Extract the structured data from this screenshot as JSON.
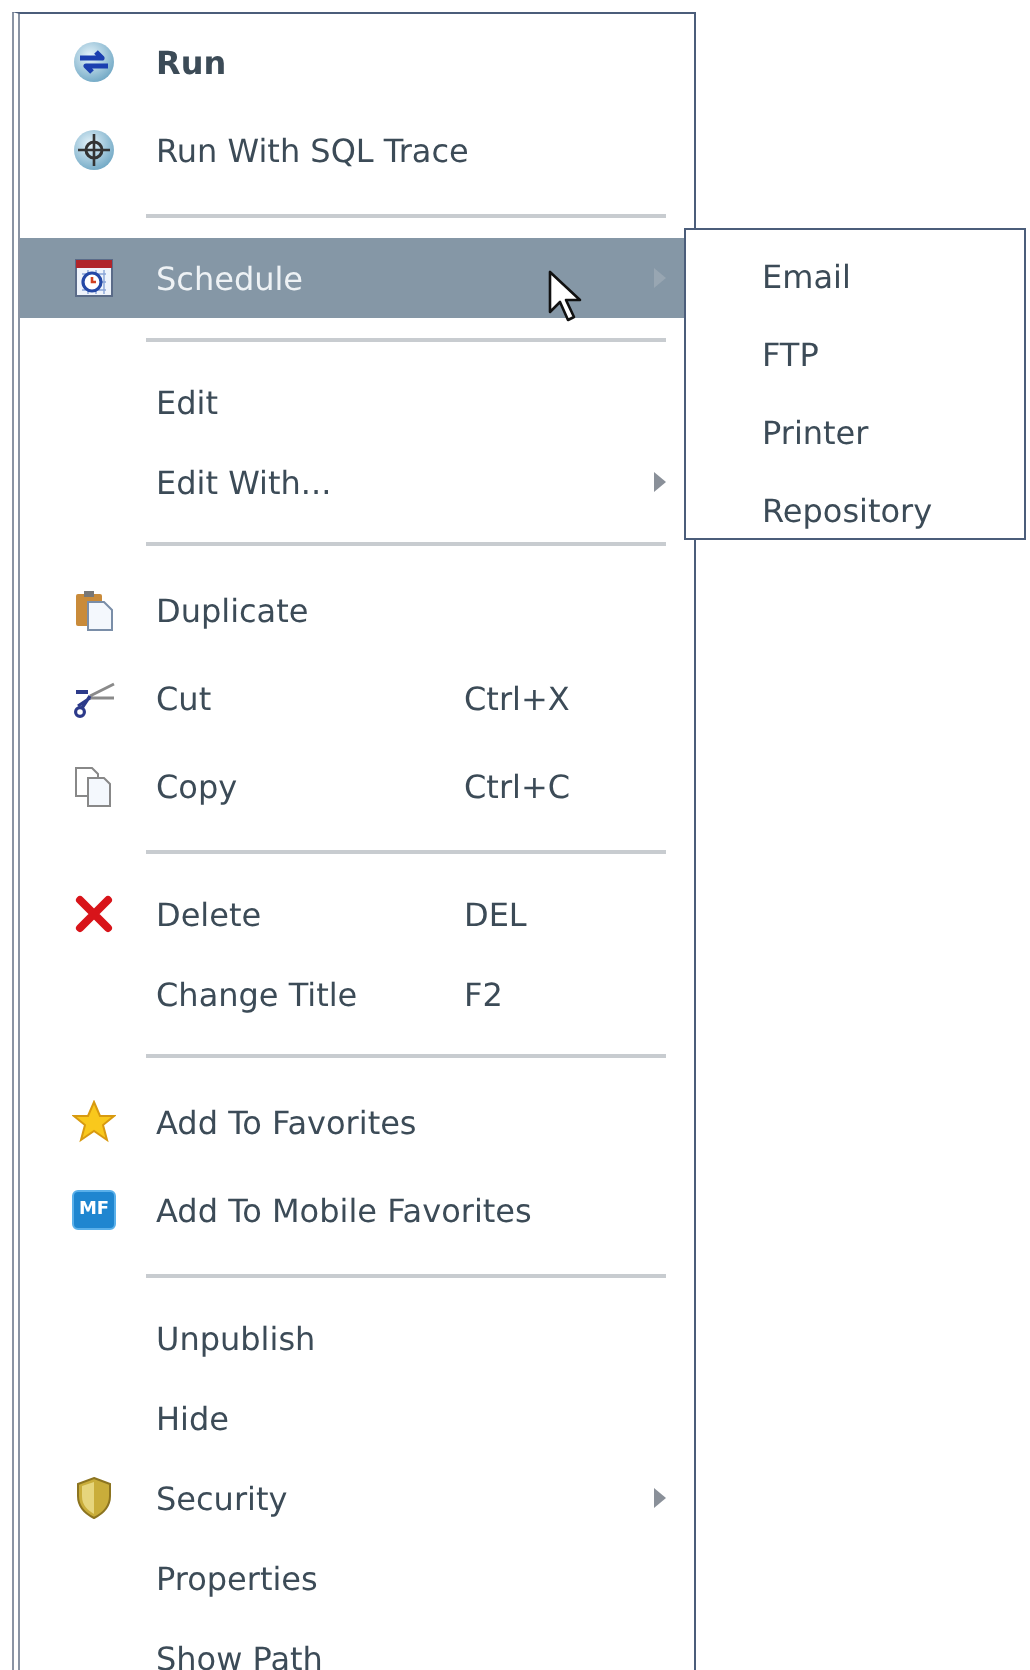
{
  "menu": {
    "items": [
      {
        "kind": "item",
        "label": "Run",
        "default": true,
        "selected": false,
        "submenu": false
      },
      {
        "kind": "item",
        "label": "Run With SQL Trace",
        "default": false,
        "selected": false,
        "submenu": false
      },
      {
        "kind": "separator"
      },
      {
        "kind": "item",
        "label": "Schedule",
        "default": false,
        "selected": true,
        "submenu": true
      },
      {
        "kind": "separator"
      },
      {
        "kind": "item",
        "label": "Edit",
        "default": false,
        "selected": false,
        "submenu": false
      },
      {
        "kind": "item",
        "label": "Edit With...",
        "default": false,
        "selected": false,
        "submenu": true
      },
      {
        "kind": "separator"
      },
      {
        "kind": "item",
        "label": "Duplicate",
        "default": false,
        "selected": false,
        "submenu": false
      },
      {
        "kind": "item",
        "label": "Cut",
        "shortcut": "Ctrl+X",
        "default": false,
        "selected": false,
        "submenu": false
      },
      {
        "kind": "item",
        "label": "Copy",
        "shortcut": "Ctrl+C",
        "default": false,
        "selected": false,
        "submenu": false
      },
      {
        "kind": "separator"
      },
      {
        "kind": "item",
        "label": "Delete",
        "shortcut": "DEL",
        "default": false,
        "selected": false,
        "submenu": false
      },
      {
        "kind": "item",
        "label": "Change Title",
        "shortcut": "F2",
        "default": false,
        "selected": false,
        "submenu": false
      },
      {
        "kind": "separator"
      },
      {
        "kind": "item",
        "label": "Add To Favorites",
        "default": false,
        "selected": false,
        "submenu": false
      },
      {
        "kind": "item",
        "label": "Add To Mobile Favorites",
        "icon_text": "MF",
        "default": false,
        "selected": false,
        "submenu": false
      },
      {
        "kind": "separator"
      },
      {
        "kind": "item",
        "label": "Unpublish",
        "default": false,
        "selected": false,
        "submenu": false
      },
      {
        "kind": "item",
        "label": "Hide",
        "default": false,
        "selected": false,
        "submenu": false
      },
      {
        "kind": "item",
        "label": "Security",
        "default": false,
        "selected": false,
        "submenu": true
      },
      {
        "kind": "item",
        "label": "Properties",
        "default": false,
        "selected": false,
        "submenu": false
      },
      {
        "kind": "item",
        "label": "Show Path",
        "default": false,
        "selected": false,
        "submenu": false
      }
    ]
  },
  "submenu": {
    "items": [
      {
        "label": "Email"
      },
      {
        "label": "FTP"
      },
      {
        "label": "Printer"
      },
      {
        "label": "Repository"
      }
    ]
  }
}
